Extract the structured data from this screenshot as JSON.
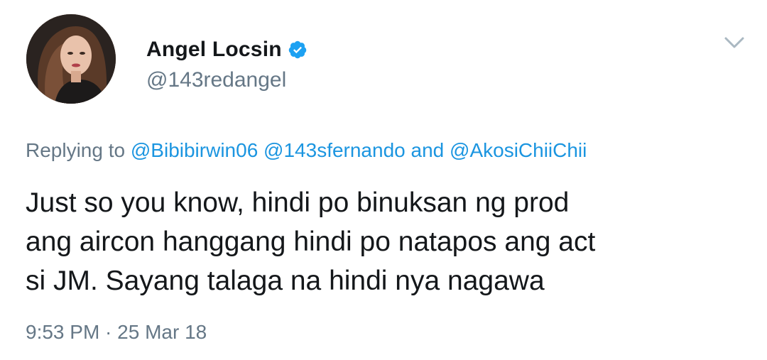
{
  "author": {
    "display_name": "Angel Locsin",
    "handle": "@143redangel",
    "verified": true
  },
  "reply": {
    "prefix": "Replying to",
    "mention_1": "@Bibibirwin06",
    "mention_2": "@143sfernando",
    "connector": "and",
    "mention_3": "@AkosiChiiChii"
  },
  "tweet": {
    "line_1": "Just so you know, hindi po binuksan ng prod",
    "line_2": "ang aircon hanggang hindi po natapos ang act",
    "line_3": "si JM. Sayang talaga na hindi nya nagawa"
  },
  "meta": {
    "timestamp": "9:53 PM · 25 Mar 18"
  },
  "colors": {
    "link": "#1b95e0",
    "secondary_text": "#657786",
    "primary_text": "#14171a"
  },
  "icons": {
    "verified": "verified-badge-icon",
    "more": "chevron-down-icon"
  }
}
